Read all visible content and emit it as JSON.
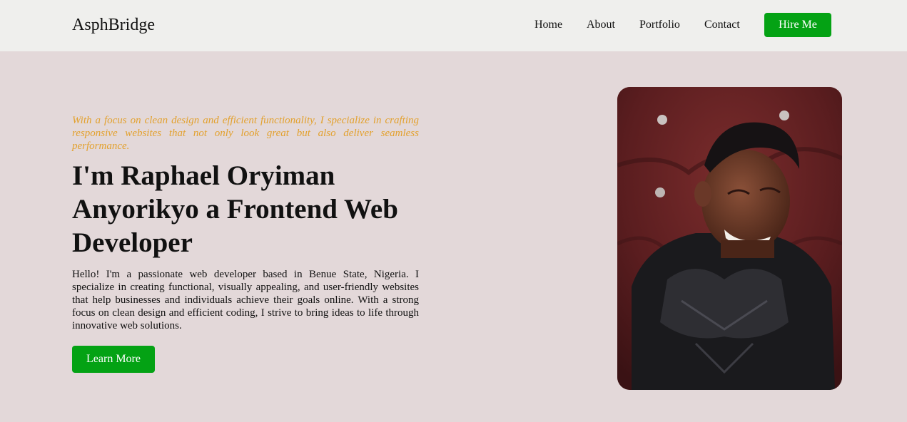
{
  "nav": {
    "brand": "AsphBridge",
    "links": [
      "Home",
      "About",
      "Portfolio",
      "Contact"
    ],
    "cta": "Hire Me"
  },
  "hero": {
    "tagline": "With a focus on clean design and efficient functionality, I specialize in crafting responsive websites that not only look great but also deliver seamless performance.",
    "heading": "I'm Raphael Oryiman Anyorikyo a Frontend Web Developer",
    "intro": "Hello! I'm a passionate web developer based in Benue State, Nigeria. I specialize in creating functional, visually appealing, and user-friendly websites that help businesses and individuals achieve their goals online. With a strong focus on clean design and efficient coding, I strive to bring ideas to life through innovative web solutions.",
    "button": "Learn More"
  },
  "colors": {
    "page_background": "#e3d8d9",
    "navbar_background": "#efefed",
    "accent_green": "#04a214",
    "tagline_orange": "#e3a12e",
    "text": "#111111"
  }
}
